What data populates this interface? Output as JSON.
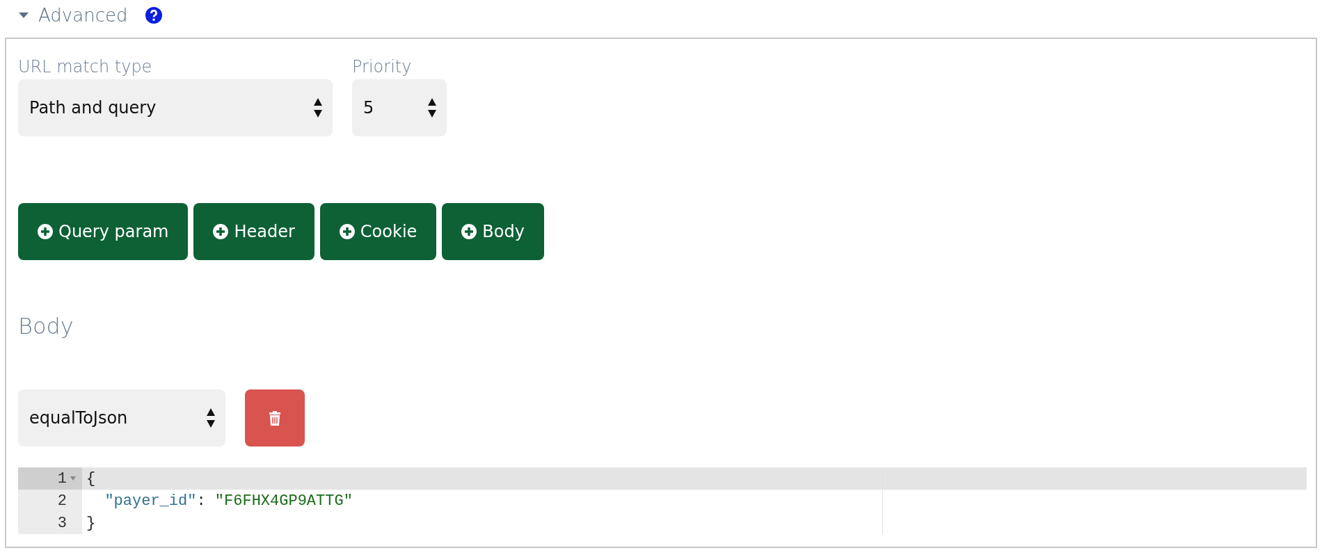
{
  "section": {
    "title": "Advanced",
    "expanded": true
  },
  "fields": [
    {
      "label": "URL match type",
      "value": "Path and query",
      "kind": "wide"
    },
    {
      "label": "Priority",
      "value": "5",
      "kind": "narrow"
    }
  ],
  "add_buttons": [
    "Query param",
    "Header",
    "Cookie",
    "Body"
  ],
  "body": {
    "heading": "Body",
    "matcher": "equalToJson",
    "editor": {
      "lines": [
        {
          "number": "1",
          "active": true,
          "foldable": true,
          "tokens": [
            {
              "kind": "punct",
              "text": "{"
            }
          ]
        },
        {
          "number": "2",
          "active": false,
          "foldable": false,
          "tokens": [
            {
              "kind": "key",
              "text": "  \"payer_id\""
            },
            {
              "kind": "punct",
              "text": ": "
            },
            {
              "kind": "string",
              "text": "\"F6FHX4GP9ATTG\""
            }
          ]
        },
        {
          "number": "3",
          "active": false,
          "foldable": false,
          "tokens": [
            {
              "kind": "punct",
              "text": "}"
            }
          ]
        }
      ]
    }
  }
}
